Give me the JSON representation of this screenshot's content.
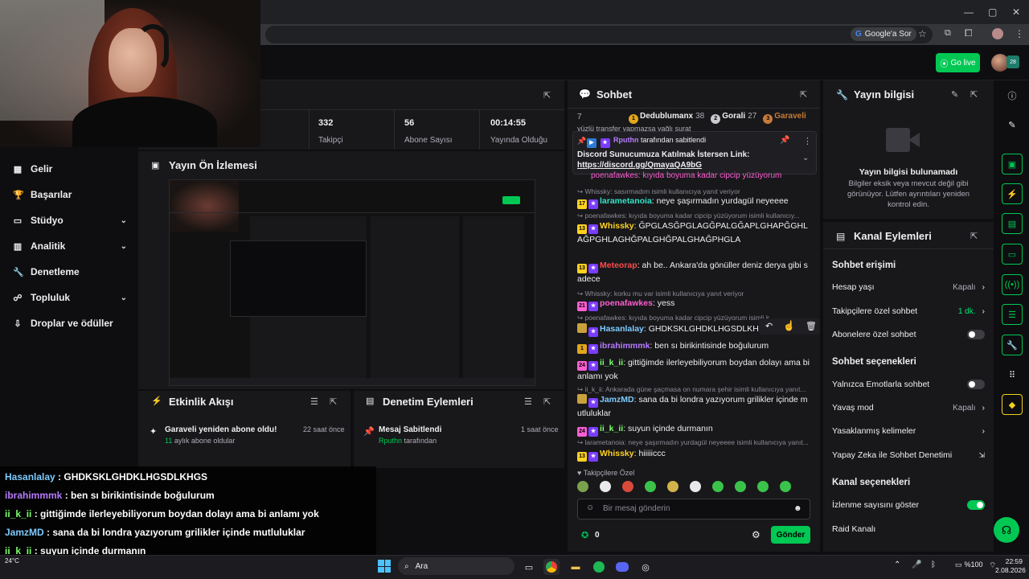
{
  "browser": {
    "google_chip": "Google'a Sor",
    "window_controls": [
      "—",
      "▢",
      "✕"
    ]
  },
  "appbar": {
    "go_live": "Go live",
    "avatar_badge": "28"
  },
  "sidebar": {
    "items": [
      {
        "label": "Gelir",
        "icon": "revenue-icon",
        "chevron": false
      },
      {
        "label": "Başarılar",
        "icon": "trophy-icon",
        "chevron": false
      },
      {
        "label": "Stüdyo",
        "icon": "studio-icon",
        "chevron": true
      },
      {
        "label": "Analitik",
        "icon": "analytics-icon",
        "chevron": true
      },
      {
        "label": "Denetleme",
        "icon": "moderation-icon",
        "chevron": false
      },
      {
        "label": "Topluluk",
        "icon": "community-icon",
        "chevron": true
      },
      {
        "label": "Droplar ve ödüller",
        "icon": "drops-icon",
        "chevron": false
      }
    ]
  },
  "stats": [
    {
      "value": "332",
      "label": "Takipçi"
    },
    {
      "value": "56",
      "label": "Abone Sayısı"
    },
    {
      "value": "00:14:55",
      "label": "Yayında Olduğu"
    }
  ],
  "preview": {
    "title": "Yayın Ön İzlemesi"
  },
  "activity": {
    "title": "Etkinlik Akışı",
    "item_title": "Garaveli yeniden abone oldu!",
    "item_time": "22 saat önce",
    "item_count": "11",
    "item_sub": "aylık abone oldular"
  },
  "modlog": {
    "title": "Denetim Eylemleri",
    "item_title": "Mesaj Sabitlendi",
    "item_time": "1 saat önce",
    "item_user": "Rputhn",
    "item_sub": "tarafından"
  },
  "chat": {
    "title": "Sohbet",
    "leaders": [
      {
        "rank": "1",
        "name": "Dedublumanx",
        "score": "38",
        "color": "#e3a61a"
      },
      {
        "rank": "2",
        "name": "Gorali",
        "score": "27",
        "color": "#c9c9cf"
      },
      {
        "rank": "3",
        "name": "Garaveli",
        "score": "",
        "color": "#c77b3a"
      }
    ],
    "top_count": "7",
    "scroll_hint": "yüzlü transfer yapmazsa yağlı surat",
    "pinned": {
      "by_user": "Rputhn",
      "by_text": "tarafından sabitlendi",
      "text": "Discord Sunucumuza Katılmak İstersen Link:",
      "link": "https://discord.gg/QmayaQA9bG"
    },
    "hidden_line": "poenafawkes: kıyıda boyuma kadar cipcip yüzüyorum",
    "messages": [
      {
        "reply": "Whissky: sasırmadım isimli kullanıcıya yanıt veriyor",
        "badge": "17",
        "user": "larametanoia",
        "color": "#2ee6c8",
        "text": "neye şaşırmadın yurdagül neyeeee"
      },
      {
        "reply": "poenafawkes: kıyıda boyuma kadar cipcip yüzüyorum isimli kullanıcıy...",
        "badge": "13",
        "user": "Whissky",
        "color": "#ffd21f",
        "text": "ĞPGLASĞPGLAGĞPALGĞAPLGHAPĞGHLAĞPGHLAGHĞPALGHĞPALGHAĞPHGLA"
      },
      {
        "reply": "",
        "badge": "13",
        "user": "Meteorap",
        "color": "#ff4a4a",
        "text": "ah be.. Ankara'da gönüller deniz derya gibi sadece"
      },
      {
        "reply": "Whissky: korku mu var isimli kullanıcıya yanıt veriyor",
        "badge": "21",
        "user": "poenafawkes",
        "color": "#ff5fd2",
        "text": "yess"
      },
      {
        "reply": "poenafawkes: kıyıda boyuma kadar cipcip yüzüyorum isimli k...",
        "badge": "",
        "user": "Hasanlalay",
        "color": "#7ecbff",
        "text": "GHDKSKLGHDKLHGSDLKHGS"
      },
      {
        "reply": "",
        "badge": "1",
        "user": "ibrahimmmk",
        "color": "#b77cff",
        "text": "ben sı birikintisinde boğulurum"
      },
      {
        "reply": "",
        "badge": "24",
        "user": "ii_k_ii",
        "color": "#7cff6a",
        "text": "gittiğimde ilerleyebiliyorum boydan dolayı ama bi anlamı yok"
      },
      {
        "reply": "ii_k_ii: Ankarada güne şaçmasa on numara şehir isimli kullanıcıya yanıt...",
        "badge": "",
        "user": "JamzMD",
        "color": "#7ecbff",
        "text": "sana da bi londra yazıyorum grilikler içinde mutluluklar"
      },
      {
        "reply": "",
        "badge": "24",
        "user": "ii_k_ii",
        "color": "#7cff6a",
        "text": "suyun içinde durmanın"
      },
      {
        "reply": "larametanoia: neye şaşırmadın yurdagül neyeeee isimli kullanıcıya yanıt...",
        "badge": "13",
        "user": "Whissky",
        "color": "#ffd21f",
        "text": "hiiiiiccc"
      }
    ],
    "emote_section": "Takipçilere Özel",
    "input_placeholder": "Bir mesaj gönderin",
    "points": "0",
    "send": "Gönder"
  },
  "stream_info": {
    "title": "Yayın bilgisi",
    "empty_title": "Yayın bilgisi bulunamadı",
    "empty_text": "Bilgiler eksik veya mevcut değil gibi görünüyor. Lütfen ayrıntıları yeniden kontrol edin."
  },
  "channel_actions": {
    "title": "Kanal Eylemleri",
    "chat_access": "Sohbet erişimi",
    "account_age": "Hesap yaşı",
    "account_age_val": "Kapalı",
    "followers_only": "Takipçilere özel sohbet",
    "followers_only_val": "1 dk.",
    "subs_only": "Abonelere özel sohbet",
    "chat_options": "Sohbet seçenekleri",
    "emote_only": "Yalnızca Emotlarla sohbet",
    "slow_mode": "Yavaş mod",
    "slow_mode_val": "Kapalı",
    "banned_words": "Yasaklanmış kelimeler",
    "ai_mod": "Yapay Zeka ile Sohbet Denetimi",
    "channel_options": "Kanal seçenekleri",
    "viewer_count": "İzlenme sayısını göster",
    "raid": "Raid Kanalı"
  },
  "overlay_chat": [
    {
      "user": "Hasanlalay",
      "color": "#7ecbff",
      "text": "GHDKSKLGHDKLHGSDLKHGS"
    },
    {
      "user": "ibrahimmmk",
      "color": "#b77cff",
      "text": "ben sı birikintisinde boğulurum"
    },
    {
      "user": "ii_k_ii",
      "color": "#7cff6a",
      "text": "gittiğimde ilerleyebiliyorum boydan dolayı ama bi anlamı yok"
    },
    {
      "user": "JamzMD",
      "color": "#7ecbff",
      "text": "sana da bi londra yazıyorum grilikler içinde mutluluklar"
    },
    {
      "user": "ii_k_ii",
      "color": "#7cff6a",
      "text": "suyun içinde durmanın"
    },
    {
      "user": "Whissky",
      "color": "#ffd21f",
      "text": "hiiiiiccc"
    }
  ],
  "taskbar": {
    "weather": "24°C",
    "search": "Ara",
    "battery": "%100",
    "time": "22:59",
    "date": "2.08.2026"
  }
}
